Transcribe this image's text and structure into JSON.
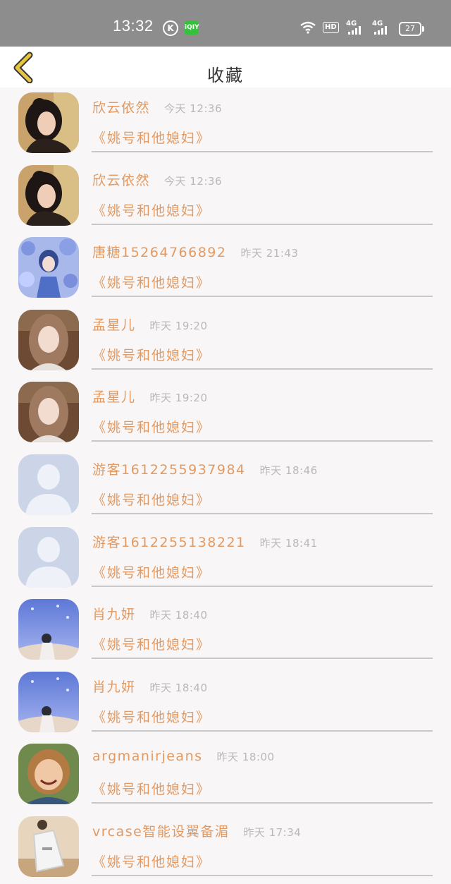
{
  "status_bar": {
    "time": "13:32",
    "left_icons": [
      "k-icon",
      "iqiyi-icon"
    ],
    "hd": "HD",
    "network": [
      "4G",
      "4G"
    ],
    "battery": "27"
  },
  "header": {
    "title": "收藏",
    "back_icon": "chevron-left-icon",
    "accent": "#e5c542"
  },
  "colors": {
    "name": "#e39a62",
    "time": "#b9b9b9",
    "title": "#e39a62",
    "divider": "#c8c8c8"
  },
  "favorites": [
    {
      "user": "欣云依然",
      "time": "今天 12:36",
      "title": "《姚号和他媳妇》",
      "avatar": "photo-girl-bun"
    },
    {
      "user": "欣云依然",
      "time": "今天 12:36",
      "title": "《姚号和他媳妇》",
      "avatar": "photo-girl-bun"
    },
    {
      "user": "唐糖15264766892",
      "time": "昨天 21:43",
      "title": "《姚号和他媳妇》",
      "avatar": "illustration-blue-flowers"
    },
    {
      "user": "孟星儿",
      "time": "昨天 19:20",
      "title": "《姚号和他媳妇》",
      "avatar": "photo-girl-long-hair"
    },
    {
      "user": "孟星儿",
      "time": "昨天 19:20",
      "title": "《姚号和他媳妇》",
      "avatar": "photo-girl-long-hair"
    },
    {
      "user": "游客1612255937984",
      "time": "昨天 18:46",
      "title": "《姚号和他媳妇》",
      "avatar": "default-person"
    },
    {
      "user": "游客1612255138221",
      "time": "昨天 18:41",
      "title": "《姚号和他媳妇》",
      "avatar": "default-person"
    },
    {
      "user": "肖九妍",
      "time": "昨天 18:40",
      "title": "《姚号和他媳妇》",
      "avatar": "photo-sky-boy"
    },
    {
      "user": "肖九妍",
      "time": "昨天 18:40",
      "title": "《姚号和他媳妇》",
      "avatar": "photo-sky-boy"
    },
    {
      "user": "argmanirjeans",
      "time": "昨天 18:00",
      "title": "《姚号和他媳妇》",
      "avatar": "photo-smiling-girl"
    },
    {
      "user": "vrcase智能设翼备湄",
      "time": "昨天 17:34",
      "title": "《姚号和他媳妇》",
      "avatar": "photo-bag"
    }
  ]
}
